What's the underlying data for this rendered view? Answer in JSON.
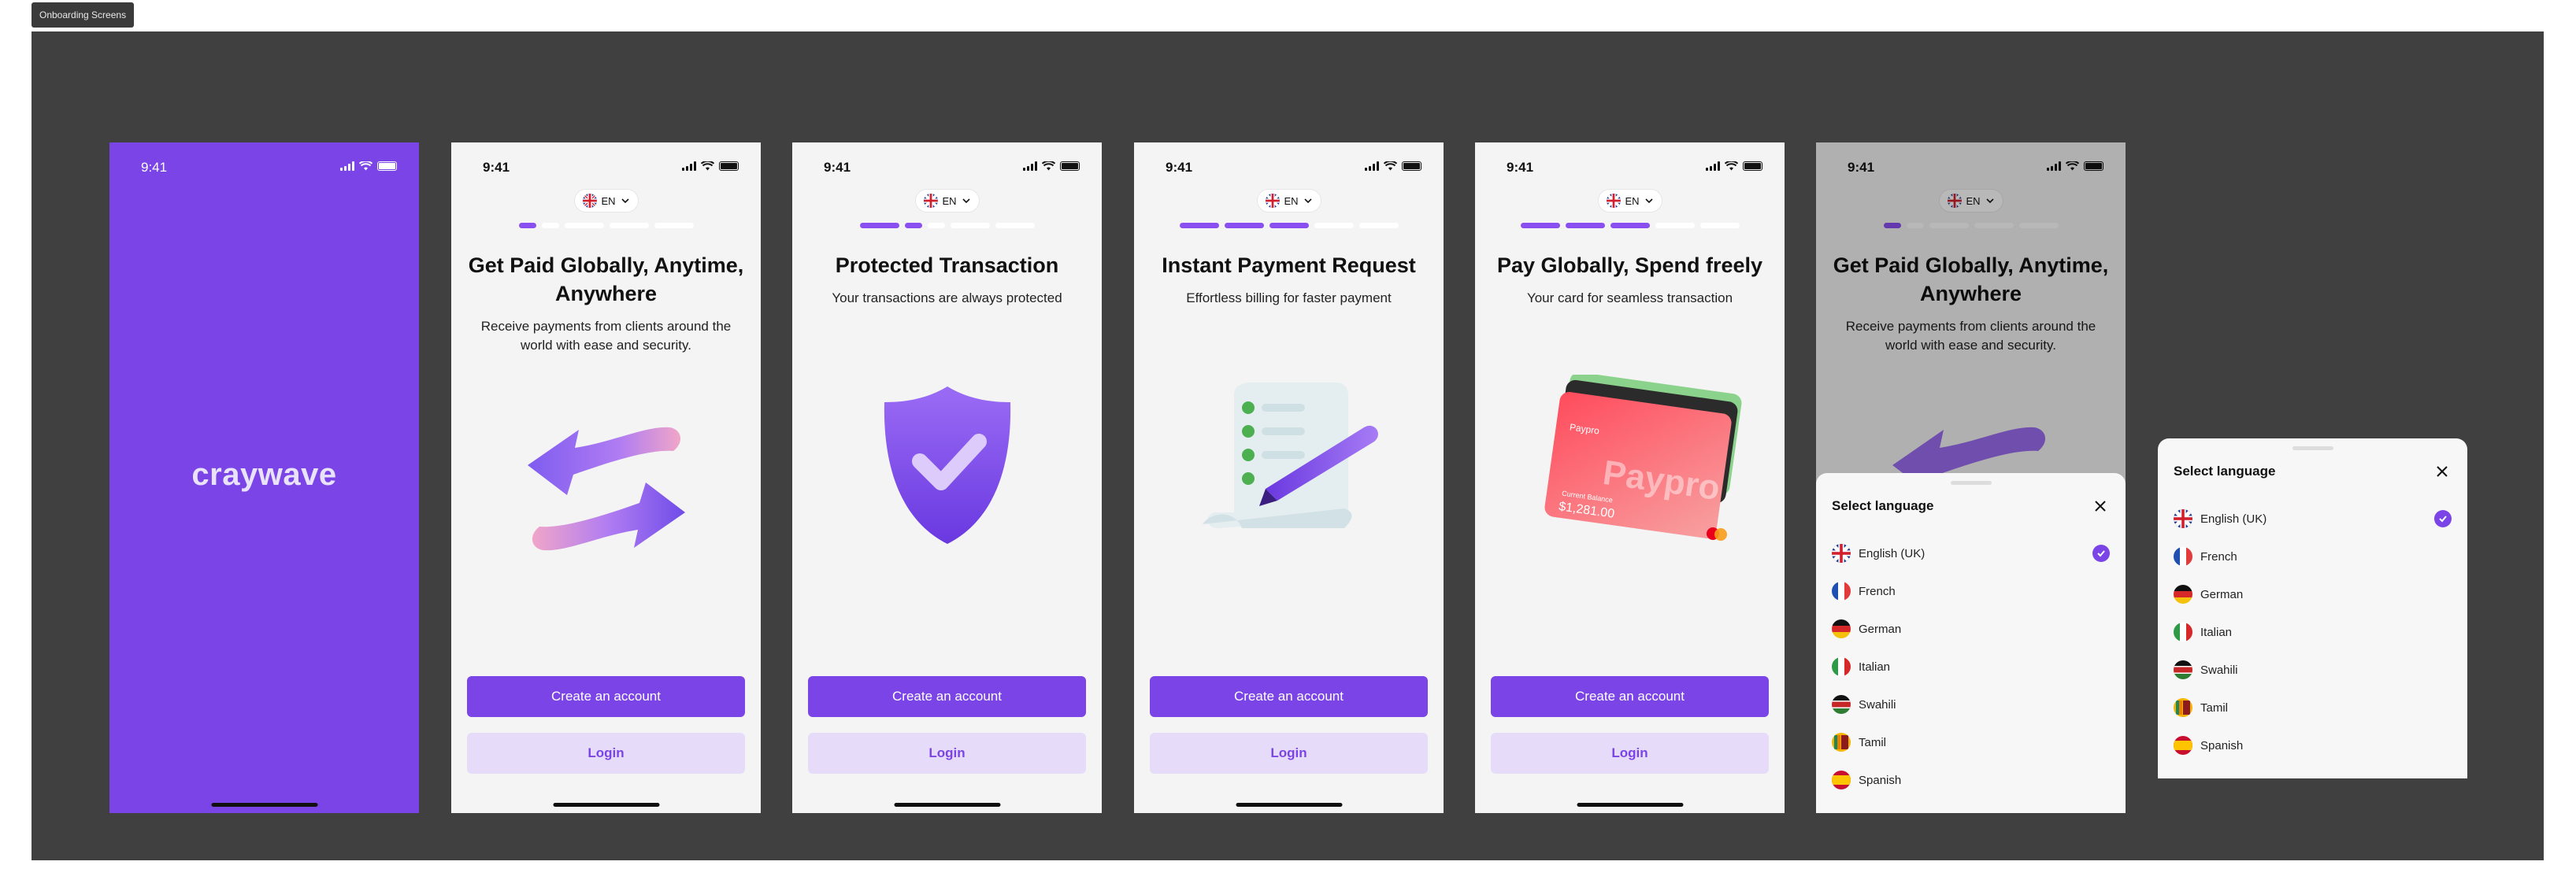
{
  "frame_label": "Onboarding Screens",
  "status_time": "9:41",
  "brand": "craywave",
  "lang_code": "EN",
  "create_account": "Create an account",
  "login": "Login",
  "screens": [
    {
      "title": "Get Paid Globally, Anytime, Anywhere",
      "subtitle": "Receive payments from clients around the world with ease and security.",
      "progress": 1
    },
    {
      "title": "Protected Transaction",
      "subtitle": "Your transactions are always protected",
      "progress": 2
    },
    {
      "title": "Instant Payment Request",
      "subtitle": "Effortless billing for faster payment",
      "progress": 3
    },
    {
      "title": "Pay Globally, Spend freely",
      "subtitle": "Your card for seamless transaction",
      "progress": 4
    }
  ],
  "card": {
    "brand_small": "Paypro",
    "brand_big": "Paypro",
    "balance_label": "Current Balance",
    "balance": "$1,281.00"
  },
  "language_sheet": {
    "title": "Select language",
    "selected": "English (UK)",
    "languages": [
      "English (UK)",
      "French",
      "German",
      "Italian",
      "Swahili",
      "Tamil",
      "Spanish"
    ]
  },
  "colors": {
    "primary": "#7b44e6",
    "primary_light": "#e6dcfa",
    "canvas": "#404040",
    "screen_bg": "#f4f4f4"
  }
}
